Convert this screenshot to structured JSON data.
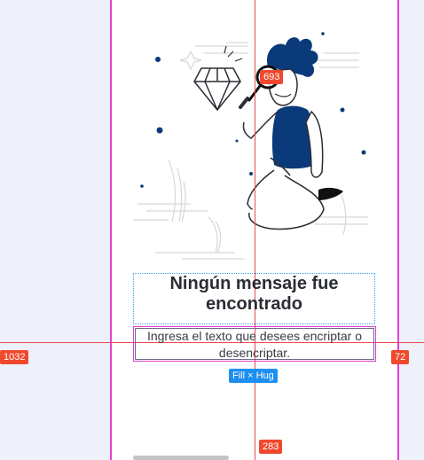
{
  "empty_state": {
    "title": "Ningún mensaje fue encontrado",
    "description": "Ingresa el texto que desees encriptar o desencriptar."
  },
  "measurements": {
    "center_badge": "693",
    "left_badge": "1032",
    "right_badge": "72",
    "bottom_badge": "283",
    "sizing_badge": "Fill × Hug"
  },
  "colors": {
    "frame_border": "#e23fd6",
    "guide_line": "#ef4a55",
    "badge_red": "#f0492e",
    "badge_blue": "#1e8ff0",
    "illustration_navy": "#0a3a7a"
  }
}
